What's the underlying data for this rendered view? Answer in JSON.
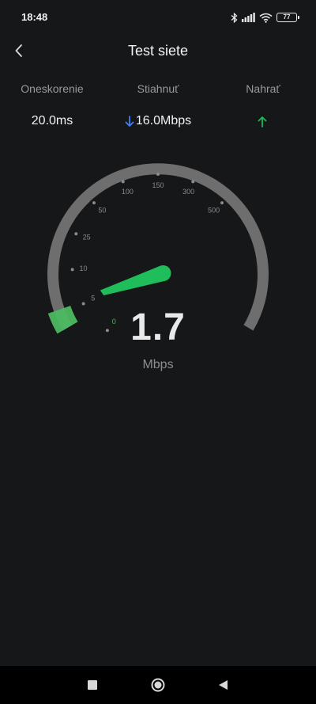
{
  "status_bar": {
    "time": "18:48",
    "battery_level": "77"
  },
  "header": {
    "title": "Test siete"
  },
  "stats": {
    "latency": {
      "label": "Oneskorenie",
      "value": "20.0ms"
    },
    "download": {
      "label": "Stiahnuť",
      "value": "16.0Mbps",
      "arrow_color": "#3f7ef6"
    },
    "upload": {
      "label": "Nahrať",
      "value": "",
      "arrow_color": "#1db954"
    }
  },
  "gauge": {
    "ticks": [
      "0",
      "5",
      "10",
      "25",
      "50",
      "100",
      "150",
      "300",
      "500"
    ],
    "current_speed": "1.7",
    "unit": "Mbps",
    "needle_color": "#1fbe5a",
    "track_color": "#6e6e6e"
  },
  "icons": {
    "back": "chevron-left-icon",
    "recents": "square-icon",
    "home": "circle-icon",
    "nav_back": "triangle-left-icon"
  }
}
